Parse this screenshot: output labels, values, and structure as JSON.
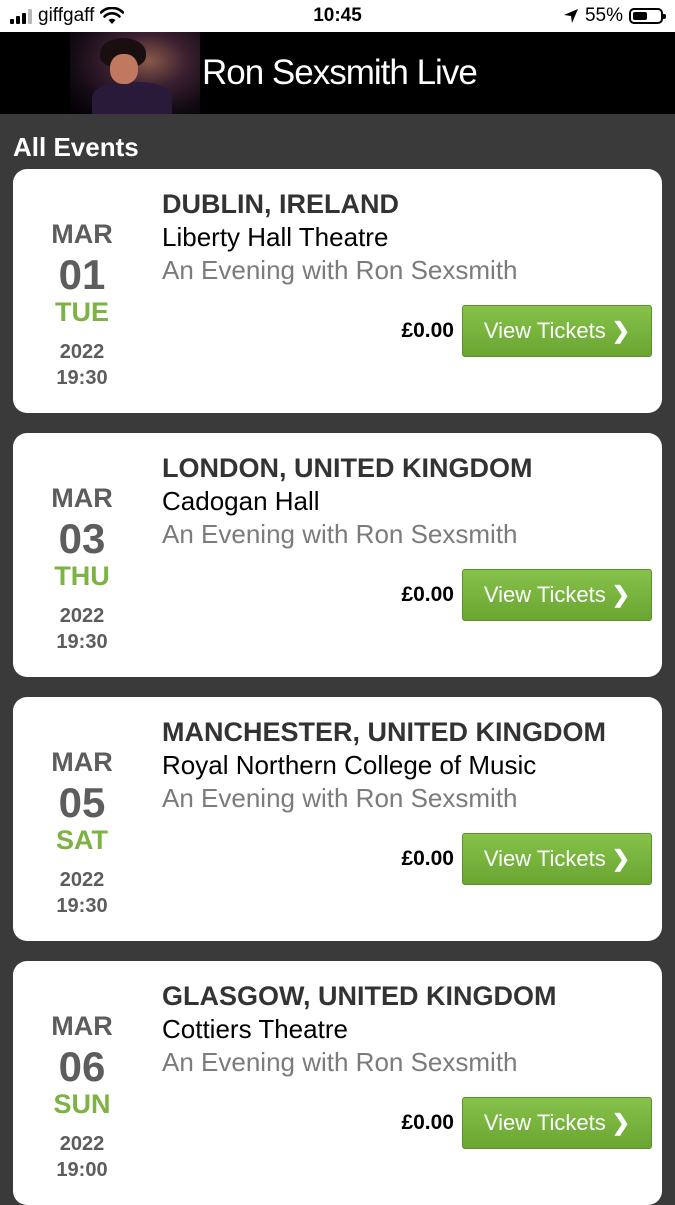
{
  "status_bar": {
    "carrier": "giffgaff",
    "time": "10:45",
    "battery": "55%",
    "battery_level": 0.55,
    "signal_bars_filled": 3,
    "icons": [
      "signal-icon",
      "wifi-icon",
      "location-arrow-icon",
      "battery-icon"
    ]
  },
  "header": {
    "title": "Ron Sexsmith Live"
  },
  "section_title": "All Events",
  "colors": {
    "background": "#3a3a3a",
    "accent_green": "#7cb342",
    "button_green": "#76b33e",
    "date_gray": "#5d5d5d",
    "subtitle_gray": "#7b7b7b"
  },
  "events": [
    {
      "month": "MAR",
      "day": "01",
      "weekday": "TUE",
      "year": "2022",
      "time": "19:30",
      "city": "DUBLIN, IRELAND",
      "venue": "Liberty Hall Theatre",
      "subtitle": "An Evening with Ron Sexsmith",
      "price": "£0.00",
      "button_label": "View Tickets"
    },
    {
      "month": "MAR",
      "day": "03",
      "weekday": "THU",
      "year": "2022",
      "time": "19:30",
      "city": "LONDON, UNITED KINGDOM",
      "venue": "Cadogan Hall",
      "subtitle": "An Evening with Ron Sexsmith",
      "price": "£0.00",
      "button_label": "View Tickets"
    },
    {
      "month": "MAR",
      "day": "05",
      "weekday": "SAT",
      "year": "2022",
      "time": "19:30",
      "city": "MANCHESTER, UNITED KINGDOM",
      "venue": "Royal Northern College of Music",
      "subtitle": "An Evening with Ron Sexsmith",
      "price": "£0.00",
      "button_label": "View Tickets"
    },
    {
      "month": "MAR",
      "day": "06",
      "weekday": "SUN",
      "year": "2022",
      "time": "19:00",
      "city": "GLASGOW, UNITED KINGDOM",
      "venue": "Cottiers Theatre",
      "subtitle": "An Evening with Ron Sexsmith",
      "price": "£0.00",
      "button_label": "View Tickets"
    }
  ]
}
